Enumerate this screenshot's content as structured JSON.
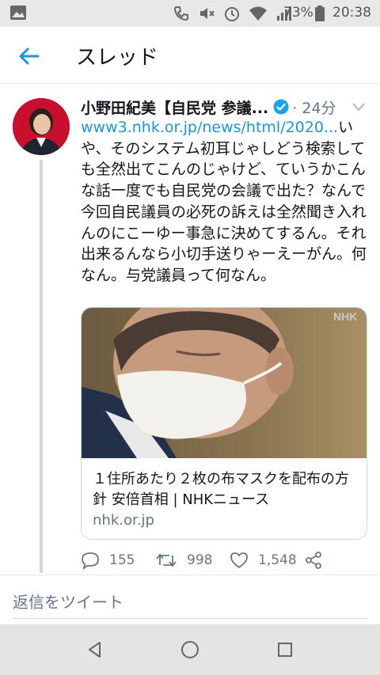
{
  "status_bar": {
    "battery_percent": "73%",
    "time": "20:38",
    "icons": [
      "gallery-icon",
      "phone-icon",
      "mute-icon",
      "alarm-icon",
      "wifi-icon",
      "signal-icon",
      "battery-icon"
    ]
  },
  "header": {
    "back_icon": "back-arrow-icon",
    "title": "スレッド"
  },
  "tweet": {
    "author_name": "小野田紀美【自民党 参議...",
    "verified": true,
    "time": "· 24分",
    "link_text": "www3.nhk.or.jp/news/html/2020...",
    "body_text": "いや、そのシステム初耳じゃしどう検索しても全然出てこんのじゃけど、ていうかこんな話一度でも自民党の会議で出た？なんで今回自民議員の必死の訴えは全然聞き入れんのにこーゆー事急に決めてするん。それ出来るんなら小切手送りゃーえーがん。何なん。与党議員って何なん。",
    "card": {
      "image_watermark": "NHK",
      "title": "１住所あたり２枚の布マスクを配布の方針 安倍首相 | NHKニュース",
      "domain": "nhk.or.jp"
    },
    "actions": {
      "replies": "155",
      "retweets": "998",
      "likes": "1,548"
    }
  },
  "reply_bar": {
    "placeholder": "返信をツイート"
  },
  "colors": {
    "accent": "#1b95e0",
    "text": "#14171a",
    "secondary": "#657786",
    "border": "#ccd6dd"
  }
}
